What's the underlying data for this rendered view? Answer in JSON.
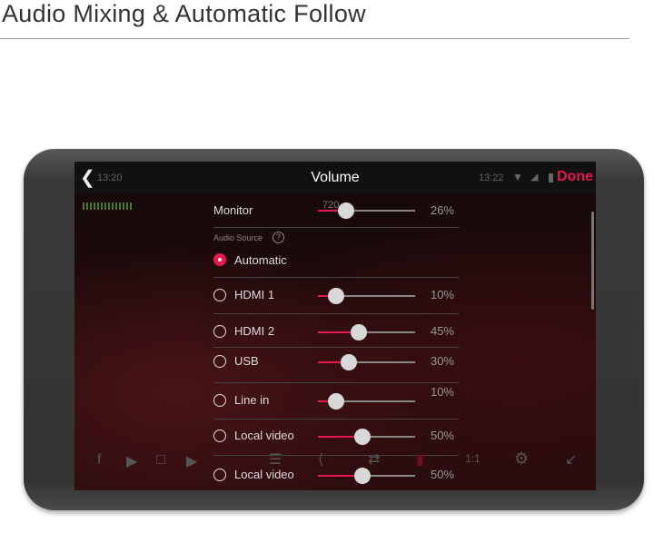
{
  "heading": "Audio Mixing & Automatic Follow",
  "screen": {
    "back_time": "13:20",
    "title": "Volume",
    "status_time": "13:22",
    "done_label": "Done",
    "accent": "#e8174d",
    "overlay_text": "720",
    "monitor": {
      "label": "Monitor",
      "value": 26,
      "value_label": "26%"
    },
    "audio_source_label": "Audio Source",
    "automatic": {
      "label": "Automatic",
      "selected": true
    },
    "sources": [
      {
        "label": "HDMI 1",
        "value": 10,
        "value_label": "10%",
        "selected": false
      },
      {
        "label": "HDMI 2",
        "value": 45,
        "value_label": "45%",
        "selected": false
      },
      {
        "label": "USB",
        "value": 30,
        "value_label": "30%",
        "selected": false
      },
      {
        "label": "Line in",
        "value": 10,
        "value_label": "10%",
        "selected": false
      },
      {
        "label": "Local video",
        "value": 50,
        "value_label": "50%",
        "selected": false
      },
      {
        "label": "Local video",
        "value": 50,
        "value_label": "50%",
        "selected": false
      }
    ],
    "toolbar_icons": [
      "facebook-icon",
      "youtube-icon",
      "twitch-icon",
      "play-icon",
      "layers-icon",
      "share-icon",
      "switch-icon",
      "volume-icon",
      "aspect-ratio-icon",
      "gear-icon",
      "collapse-icon"
    ]
  }
}
